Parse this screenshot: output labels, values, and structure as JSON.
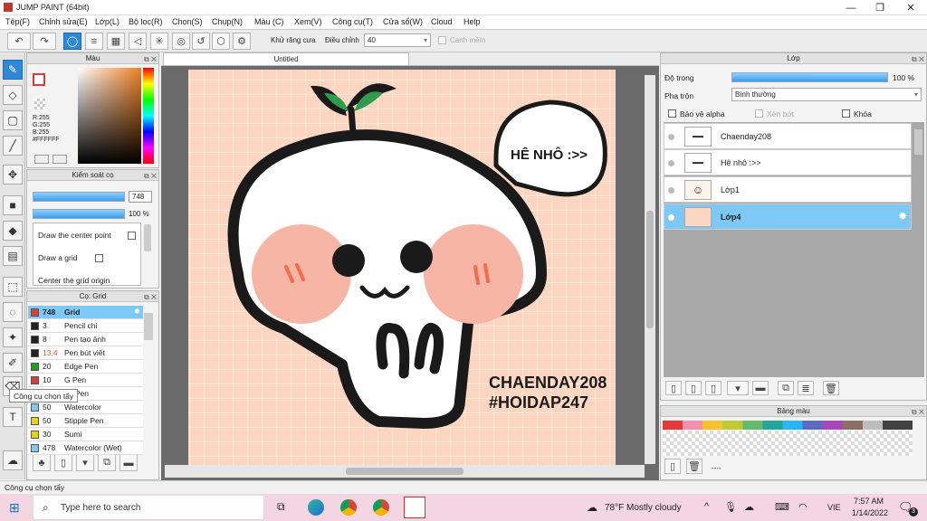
{
  "window": {
    "title": "JUMP PAINT (64bit)"
  },
  "menu": [
    "Tệp(F)",
    "Chỉnh sửa(E)",
    "Lớp(L)",
    "Bộ lọc(R)",
    "Chọn(S)",
    "Chụp(N)",
    "Màu (C)",
    "Xem(V)",
    "Công cụ(T)",
    "Cửa sổ(W)",
    "Cloud",
    "Help"
  ],
  "toolbar": {
    "antialias": "Khử răng cưa",
    "adjust": "Điều chỉnh",
    "adjust_value": "40",
    "snap": "Canh mềm"
  },
  "color_panel": {
    "title": "Màu",
    "r": "R:255",
    "g": "G:255",
    "b": "B:255",
    "hex": "#FFFFFF"
  },
  "brush_control": {
    "title": "Kiểm soát cọ",
    "size": "748",
    "opacity": "100 %",
    "size_fill": 0.85,
    "opacity_fill": 1.0,
    "options": [
      "Draw the center point",
      "Draw a grid",
      "Center the grid origin"
    ]
  },
  "brush_list": {
    "title": "Cọ: Grid",
    "items": [
      {
        "size": "748",
        "name": "Grid",
        "color": "#e53935",
        "selected": true
      },
      {
        "size": "3",
        "name": "Pencil chì",
        "color": "#222222"
      },
      {
        "size": "8",
        "name": "Pen tạo ảnh",
        "color": "#222222"
      },
      {
        "size": "13,4",
        "name": "Pen bút viết",
        "color": "#222222"
      },
      {
        "size": "20",
        "name": "Edge Pen",
        "color": "#1aa51a"
      },
      {
        "size": "10",
        "name": "G Pen",
        "color": "#e53935"
      },
      {
        "size": "",
        "name": "ng Pen",
        "color": "#888888"
      },
      {
        "size": "50",
        "name": "Watercolor",
        "color": "#7ec8f5"
      },
      {
        "size": "50",
        "name": "Stipple Pen",
        "color": "#e8d600"
      },
      {
        "size": "30",
        "name": "Sumi",
        "color": "#e8d600"
      },
      {
        "size": "478",
        "name": "Watercolor (Wet)",
        "color": "#7ec8f5"
      }
    ]
  },
  "tooltip": "Công cụ chọn tẩy",
  "document": {
    "tab": "Untitled",
    "speech": "HÊ NHÔ :>>",
    "sign1": "CHAENDAY208",
    "sign2": "#HOIDAP247"
  },
  "layer_panel": {
    "title": "Lớp",
    "opacity_label": "Độ trong",
    "opacity": "100 %",
    "opacity_fill": 1.0,
    "blend_label": "Pha trộn",
    "blend": "Bình thường",
    "protect_alpha": "Bảo vệ alpha",
    "clip": "Xén bớt",
    "lock": "Khóa",
    "layers": [
      {
        "name": "Chaenday208",
        "selected": false
      },
      {
        "name": "Hê nhô :>>",
        "selected": false
      },
      {
        "name": "Lớp1",
        "selected": false
      },
      {
        "name": "Lớp4",
        "selected": true
      }
    ]
  },
  "palette": {
    "title": "Bảng màu",
    "more": "----"
  },
  "status": "Công cụ chọn tẩy",
  "taskbar": {
    "search": "Type here to search",
    "weather": "78°F  Mostly cloudy",
    "lang": "VIE",
    "time": "7:57 AM",
    "date": "1/14/2022",
    "notif": "3"
  }
}
